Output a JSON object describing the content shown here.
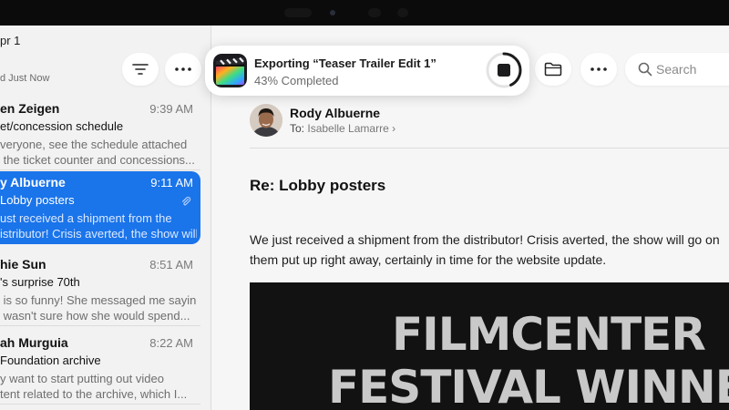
{
  "mail_list": {
    "date_header": "pr 1",
    "updated_text": "d Just Now",
    "messages": [
      {
        "sender": "en Zeigen",
        "time": "9:39 AM",
        "subject": "et/concession schedule",
        "preview": "veryone, see the schedule attached\n the ticket counter and concessions...",
        "selected": false,
        "attachment": false
      },
      {
        "sender": "y Albuerne",
        "time": "9:11 AM",
        "subject": "Lobby posters",
        "preview": "ust received a shipment from the\nistributor! Crisis averted, the show will...",
        "selected": true,
        "attachment": true
      },
      {
        "sender": "hie Sun",
        "time": "8:51 AM",
        "subject": "'s surprise 70th",
        "preview": " is so funny! She messaged me saying\n wasn't sure how she would spend...",
        "selected": false,
        "attachment": false
      },
      {
        "sender": "ah Murguia",
        "time": "8:22 AM",
        "subject": "Foundation archive",
        "preview": "y want to start putting out video\ntent related to the archive, which I...",
        "selected": false,
        "attachment": false
      }
    ]
  },
  "toolbar": {
    "filter_icon": "filter-lines-icon",
    "more_icon": "ellipsis-icon",
    "folder_icon": "folder-icon",
    "search_placeholder": "Search"
  },
  "export_notification": {
    "app_icon": "final-cut-pro-icon",
    "title": "Exporting “Teaser Trailer Edit 1”",
    "status": "43% Completed",
    "progress": 0.43
  },
  "message": {
    "from_name": "Rody Albuerne",
    "to_label": "To:",
    "to_name": "Isabelle Lamarre",
    "subject": "Re: Lobby posters",
    "body": "We just received a shipment from the distributor! Crisis averted, the show will go on\nthem put up right away, certainly in time for the website update.",
    "poster_line1": "FILMCENTER",
    "poster_line2": "FESTIVAL WINNERS"
  },
  "colors": {
    "accent": "#1a74ea",
    "progress_ring": "#1c1c1e",
    "poster_bg": "#121212"
  }
}
